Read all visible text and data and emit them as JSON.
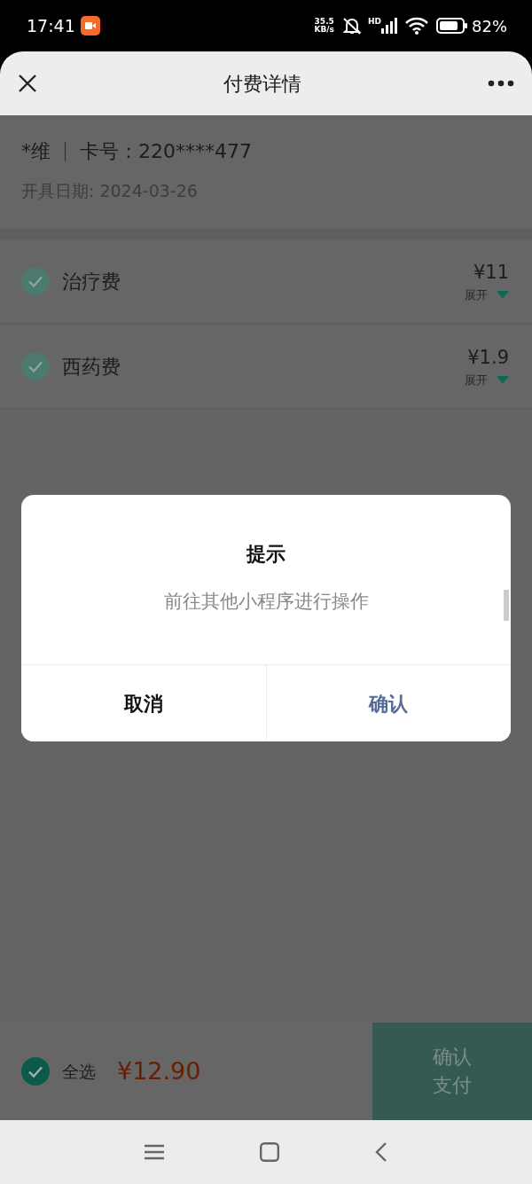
{
  "status_bar": {
    "time": "17:41",
    "net_speed": "35.5",
    "net_unit": "KB/s",
    "signal_tag": "HD",
    "battery": "82%"
  },
  "header": {
    "title": "付费详情"
  },
  "patient": {
    "name": "*维",
    "card": "卡号：220****477",
    "date": "开具日期: 2024-03-26"
  },
  "items": [
    {
      "name": "治疗费",
      "checked": true,
      "amount": "¥11",
      "toggle": "展开"
    },
    {
      "name": "西药费",
      "checked": true,
      "amount": "¥1.9",
      "toggle": "展开"
    }
  ],
  "dialog": {
    "title": "提示",
    "message": "前往其他小程序进行操作",
    "buttons": [
      {
        "label": "取消",
        "kind": "cancel"
      },
      {
        "label": "确认",
        "kind": "confirm"
      }
    ]
  },
  "footer": {
    "select_all": {
      "label": "全选",
      "checked": true
    },
    "total": "¥12.90",
    "pay_button": [
      "确认",
      "支付"
    ]
  }
}
